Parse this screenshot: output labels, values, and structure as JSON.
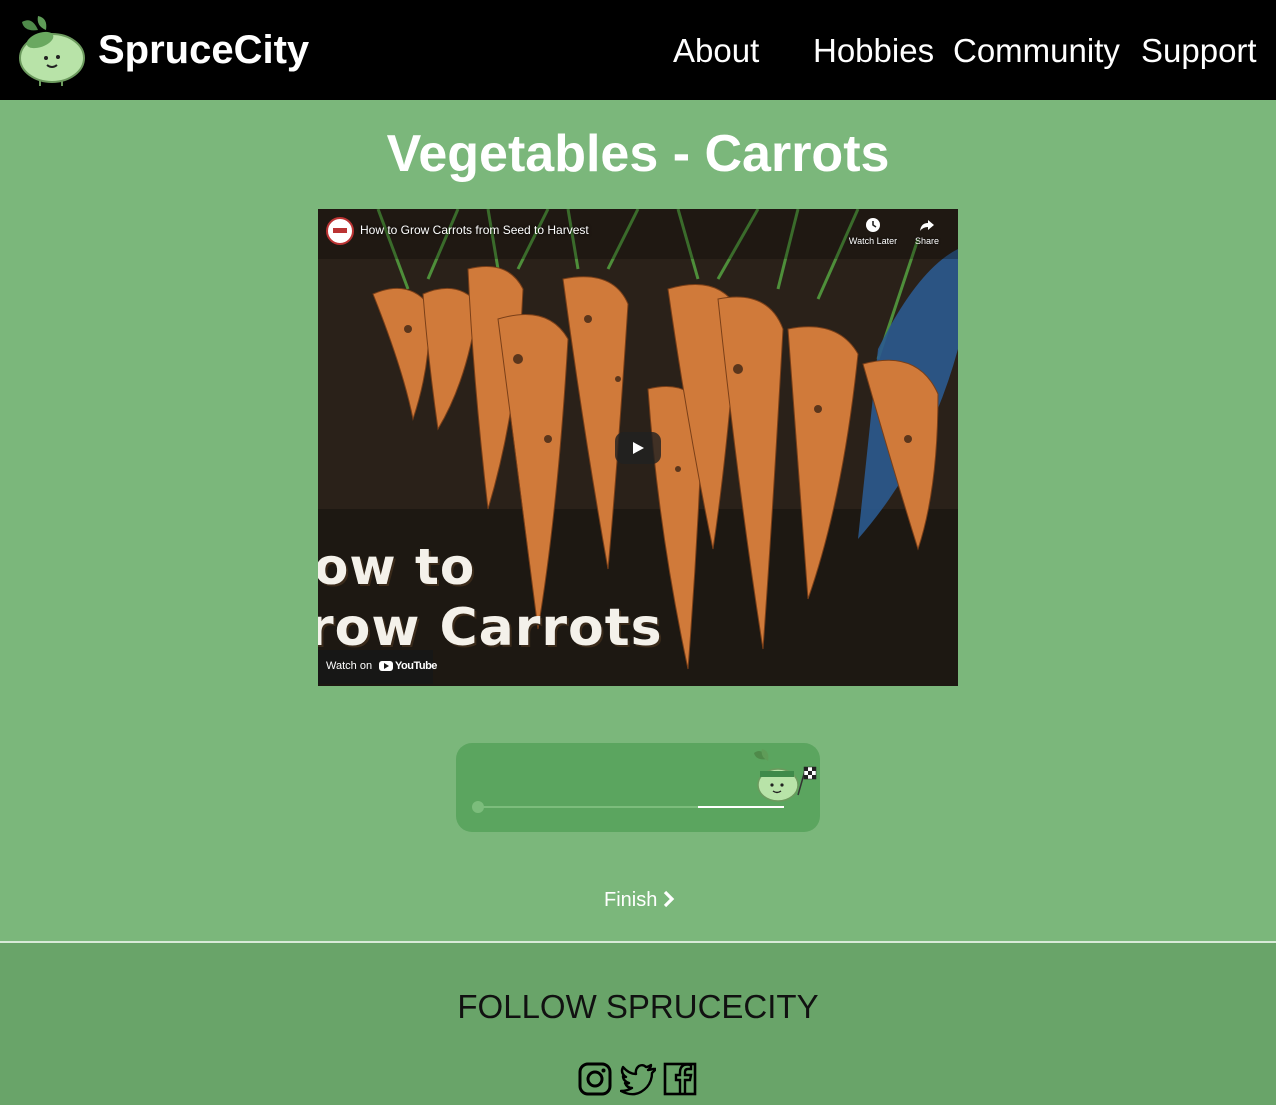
{
  "header": {
    "brand": "SpruceCity",
    "nav": [
      {
        "label": "About"
      },
      {
        "label": "Hobbies"
      },
      {
        "label": "Community"
      },
      {
        "label": "Support"
      }
    ]
  },
  "main": {
    "title": "Vegetables - Carrots",
    "video": {
      "title": "How to Grow Carrots from Seed to Harvest",
      "watch_later": "Watch Later",
      "share": "Share",
      "overlay_line1": "ow to",
      "overlay_line2": "row Carrots",
      "watch_on": "Watch on",
      "platform": "YouTube"
    },
    "progress": {
      "value_fraction": 0.28
    },
    "finish_label": "Finish"
  },
  "footer": {
    "follow_title": "FOLLOW SPRUCECITY",
    "social_icons": [
      "instagram-icon",
      "twitter-icon",
      "facebook-icon"
    ]
  },
  "colors": {
    "header_bg": "#000000",
    "page_bg": "#7bb77b",
    "card_bg": "#5ba55f",
    "footer_bg": "#69a469"
  }
}
